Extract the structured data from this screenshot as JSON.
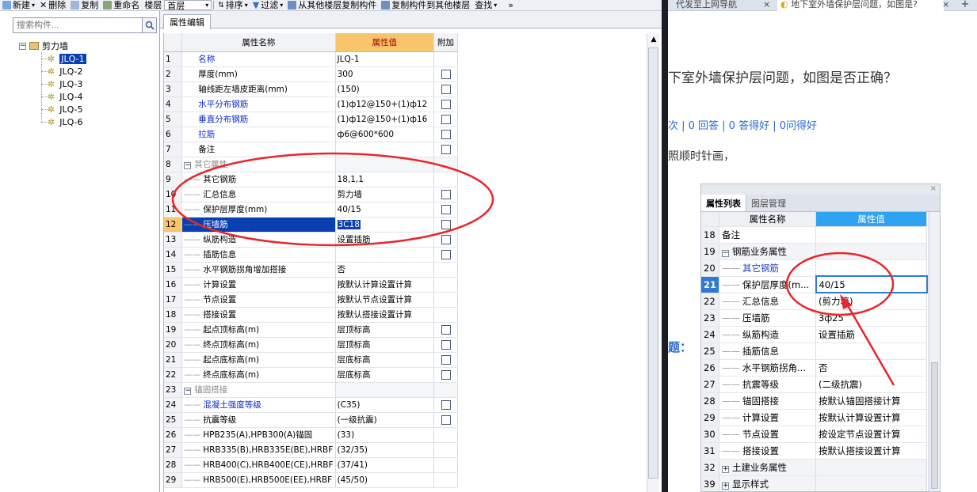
{
  "toolbar": {
    "items": [
      {
        "label": "新建",
        "dropdown": true
      },
      {
        "label": "删除",
        "dropdown": false
      },
      {
        "label": "复制",
        "dropdown": false
      },
      {
        "label": "重命名",
        "dropdown": false
      },
      {
        "label": "楼层",
        "dropdown": false
      }
    ],
    "floor_select": "首层",
    "items2": [
      {
        "label": "排序",
        "dropdown": true
      },
      {
        "label": "过滤",
        "dropdown": true
      },
      {
        "label": "从其他楼层复制构件",
        "dropdown": false
      },
      {
        "label": "复制构件到其他楼层",
        "dropdown": false
      },
      {
        "label": "查找",
        "dropdown": true
      }
    ],
    "overflow": "»"
  },
  "search": {
    "placeholder": "搜索构件..."
  },
  "tree": {
    "root": "剪力墙",
    "items": [
      "JLQ-1",
      "JLQ-2",
      "JLQ-3",
      "JLQ-4",
      "JLQ-5",
      "JLQ-6"
    ],
    "selected": "JLQ-1"
  },
  "panel_tab": "属性编辑",
  "grid": {
    "headers": [
      "属性名称",
      "属性值",
      "附加"
    ],
    "rows": [
      {
        "n": "1",
        "name": "名称",
        "value": "JLQ-1",
        "blue": true,
        "cb": false,
        "indent": 0
      },
      {
        "n": "2",
        "name": "厚度(mm)",
        "value": "300",
        "blue": false,
        "cb": true,
        "indent": 0
      },
      {
        "n": "3",
        "name": "轴线距左墙皮距离(mm)",
        "value": "(150)",
        "blue": false,
        "cb": true,
        "indent": 0
      },
      {
        "n": "4",
        "name": "水平分布钢筋",
        "value": "(1)ф12@150+(1)ф12",
        "blue": true,
        "cb": true,
        "indent": 0
      },
      {
        "n": "5",
        "name": "垂直分布钢筋",
        "value": "(1)ф12@150+(1)ф16",
        "blue": true,
        "cb": true,
        "indent": 0
      },
      {
        "n": "6",
        "name": "拉筋",
        "value": "ф6@600*600",
        "blue": true,
        "cb": true,
        "indent": 0
      },
      {
        "n": "7",
        "name": "备注",
        "value": "",
        "blue": false,
        "cb": true,
        "indent": 0
      },
      {
        "n": "8",
        "name": "其它属性",
        "value": "",
        "blue": false,
        "cb": false,
        "group": true
      },
      {
        "n": "9",
        "name": "其它钢筋",
        "value": "18,1,1",
        "blue": false,
        "cb": false,
        "indent": 1
      },
      {
        "n": "10",
        "name": "汇总信息",
        "value": "剪力墙",
        "blue": false,
        "cb": true,
        "indent": 1
      },
      {
        "n": "11",
        "name": "保护层厚度(mm)",
        "value": "40/15",
        "blue": false,
        "cb": true,
        "indent": 1
      },
      {
        "n": "12",
        "name": "压墙筋",
        "value": "3C18",
        "blue": false,
        "cb": true,
        "indent": 1,
        "selected": true
      },
      {
        "n": "13",
        "name": "纵筋构造",
        "value": "设置插筋",
        "blue": false,
        "cb": true,
        "indent": 1
      },
      {
        "n": "14",
        "name": "插筋信息",
        "value": "",
        "blue": false,
        "cb": true,
        "indent": 1
      },
      {
        "n": "15",
        "name": "水平钢筋拐角增加搭接",
        "value": "否",
        "blue": false,
        "cb": false,
        "indent": 1
      },
      {
        "n": "16",
        "name": "计算设置",
        "value": "按默认计算设置计算",
        "blue": false,
        "cb": false,
        "indent": 1
      },
      {
        "n": "17",
        "name": "节点设置",
        "value": "按默认节点设置计算",
        "blue": false,
        "cb": false,
        "indent": 1
      },
      {
        "n": "18",
        "name": "搭接设置",
        "value": "按默认搭接设置计算",
        "blue": false,
        "cb": false,
        "indent": 1
      },
      {
        "n": "19",
        "name": "起点顶标高(m)",
        "value": "层顶标高",
        "blue": false,
        "cb": true,
        "indent": 1
      },
      {
        "n": "20",
        "name": "终点顶标高(m)",
        "value": "层顶标高",
        "blue": false,
        "cb": true,
        "indent": 1
      },
      {
        "n": "21",
        "name": "起点底标高(m)",
        "value": "层底标高",
        "blue": false,
        "cb": true,
        "indent": 1
      },
      {
        "n": "22",
        "name": "终点底标高(m)",
        "value": "层底标高",
        "blue": false,
        "cb": true,
        "indent": 1
      },
      {
        "n": "23",
        "name": "锚固搭接",
        "value": "",
        "blue": false,
        "cb": false,
        "group": true
      },
      {
        "n": "24",
        "name": "混凝土强度等级",
        "value": "(C35)",
        "blue": true,
        "cb": true,
        "indent": 1
      },
      {
        "n": "25",
        "name": "抗震等级",
        "value": "(一级抗震)",
        "blue": false,
        "cb": true,
        "indent": 1
      },
      {
        "n": "26",
        "name": "HPB235(A),HPB300(A)锚固",
        "value": "(33)",
        "blue": false,
        "cb": false,
        "indent": 1
      },
      {
        "n": "27",
        "name": "HRB335(B),HRB335E(BE),HRBF",
        "value": "(32/35)",
        "blue": false,
        "cb": false,
        "indent": 1
      },
      {
        "n": "28",
        "name": "HRB400(C),HRB400E(CE),HRBF",
        "value": "(37/41)",
        "blue": false,
        "cb": false,
        "indent": 1
      },
      {
        "n": "29",
        "name": "HRB500(E),HRB500E(EE),HRBF",
        "value": "(45/50)",
        "blue": false,
        "cb": false,
        "indent": 1
      }
    ]
  },
  "browser": {
    "tabs": [
      {
        "title": "代发至上网导航",
        "close": "×"
      },
      {
        "title": "地下室外墙保护层问题，如图是?",
        "close": "×"
      }
    ],
    "new_tab": "+",
    "question_title": "下室外墙保护层问题，如图是否正确？",
    "stats": "次 | 0 回答 | 0 答得好 | 0问得好",
    "text": "照顺时针画，",
    "label": "题："
  },
  "screenshot": {
    "close": "×",
    "tabs": [
      "属性列表",
      "图层管理"
    ],
    "headers": [
      "属性名称",
      "属性值"
    ],
    "rows": [
      {
        "n": "18",
        "name": "备注",
        "value": "",
        "indent": 0
      },
      {
        "n": "19",
        "name": "钢筋业务属性",
        "value": "",
        "group": true
      },
      {
        "n": "20",
        "name": "其它钢筋",
        "value": "",
        "indent": 1,
        "blue": true
      },
      {
        "n": "21",
        "name": "保护层厚度(m...",
        "value": "40/15",
        "indent": 1,
        "selected": true
      },
      {
        "n": "22",
        "name": "汇总信息",
        "value": "(剪力墙)",
        "indent": 1
      },
      {
        "n": "23",
        "name": "压墙筋",
        "value": "3ф25",
        "indent": 1
      },
      {
        "n": "24",
        "name": "纵筋构造",
        "value": "设置插筋",
        "indent": 1
      },
      {
        "n": "25",
        "name": "插筋信息",
        "value": "",
        "indent": 1
      },
      {
        "n": "26",
        "name": "水平钢筋拐角...",
        "value": "否",
        "indent": 1
      },
      {
        "n": "27",
        "name": "抗震等级",
        "value": "(二级抗震)",
        "indent": 1
      },
      {
        "n": "28",
        "name": "锚固搭接",
        "value": "按默认锚固搭接计算",
        "indent": 1
      },
      {
        "n": "29",
        "name": "计算设置",
        "value": "按默认计算设置计算",
        "indent": 1
      },
      {
        "n": "30",
        "name": "节点设置",
        "value": "按设定节点设置计算",
        "indent": 1
      },
      {
        "n": "31",
        "name": "搭接设置",
        "value": "按默认搭接设置计算",
        "indent": 1
      },
      {
        "n": "32",
        "name": "土建业务属性",
        "value": "",
        "group": true,
        "plus": true
      },
      {
        "n": "39",
        "name": "显示样式",
        "value": "",
        "group": true,
        "plus": true
      }
    ]
  },
  "colors": {
    "annotation_red": "#e8262b",
    "selection_blue": "#0a3fb0",
    "header_orange": "#f9c56a"
  }
}
